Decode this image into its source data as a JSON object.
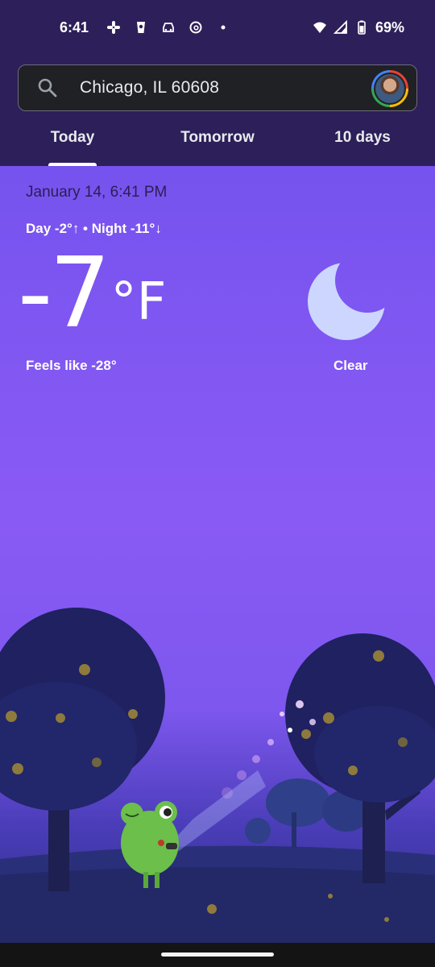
{
  "status_bar": {
    "time": "6:41",
    "notification_icons": [
      "slack-icon",
      "cup-icon",
      "car-icon",
      "threads-icon",
      "dot-icon"
    ],
    "battery": "69%"
  },
  "search": {
    "location": "Chicago, IL 60608"
  },
  "tabs": [
    {
      "label": "Today",
      "selected": true
    },
    {
      "label": "Tomorrow",
      "selected": false
    },
    {
      "label": "10 days",
      "selected": false
    }
  ],
  "weather": {
    "datetime": "January 14, 6:41 PM",
    "day_night": "Day -2°↑ • Night -11°↓",
    "temperature": "-7",
    "unit": "°F",
    "feels_like": "Feels like -28°",
    "condition": "Clear",
    "condition_icon": "moon-icon"
  },
  "colors": {
    "header_bg": "#2d1f59",
    "sky_top": "#7653ee",
    "sky_mid": "#8a5af5",
    "text_dark": "#2a1e55"
  }
}
